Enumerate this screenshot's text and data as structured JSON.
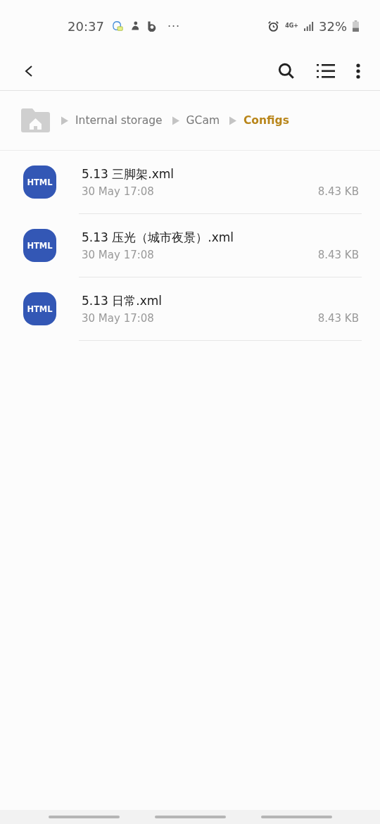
{
  "status_bar": {
    "time": "20:37",
    "more": "···",
    "network": "4G+",
    "battery": "32%"
  },
  "breadcrumb": [
    {
      "label": "Internal storage",
      "selected": false
    },
    {
      "label": "GCam",
      "selected": false
    },
    {
      "label": "Configs",
      "selected": true
    }
  ],
  "files": [
    {
      "icon_label": "HTML",
      "name": "5.13 三脚架.xml",
      "date": "30 May 17:08",
      "size": "8.43 KB"
    },
    {
      "icon_label": "HTML",
      "name": "5.13 压光（城市夜景）.xml",
      "date": "30 May 17:08",
      "size": "8.43 KB"
    },
    {
      "icon_label": "HTML",
      "name": "5.13 日常.xml",
      "date": "30 May 17:08",
      "size": "8.43 KB"
    }
  ]
}
